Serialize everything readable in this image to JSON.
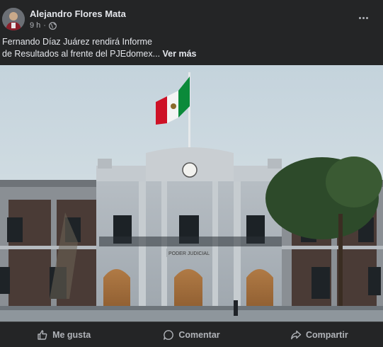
{
  "post": {
    "author": "Alejandro Flores Mata",
    "time": "9 h",
    "separator": "·",
    "text": "Fernando Díaz Juárez rendirá Informe\nde Resultados al frente del PJEdomex... ",
    "see_more": "Ver más",
    "building_sign": "PODER JUDICIAL"
  },
  "actions": {
    "like": "Me gusta",
    "comment": "Comentar",
    "share": "Compartir"
  },
  "icons": {
    "privacy": "globe-icon",
    "menu": "more-options-icon",
    "like": "thumbs-up-icon",
    "comment": "comment-icon",
    "share": "share-icon"
  },
  "colors": {
    "card_bg": "#242526",
    "text_primary": "#e4e6eb",
    "text_secondary": "#b0b3b8"
  }
}
